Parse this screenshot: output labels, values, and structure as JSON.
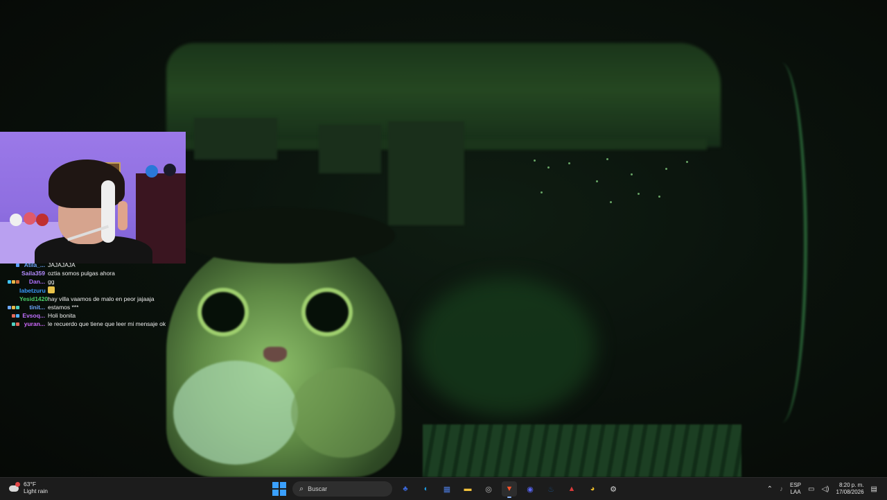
{
  "chat": [
    {
      "user": "Atila_...",
      "color": "#6ea8ff",
      "badges": [
        "#5aa0ff"
      ],
      "message": "JAJAJAJA",
      "emote": false
    },
    {
      "user": "Saila359",
      "color": "#b58cff",
      "badges": [],
      "message": "oztia somos pulgas ahora",
      "emote": false
    },
    {
      "user": "Dan...",
      "color": "#b070ff",
      "badges": [
        "#3fc6ff",
        "#e6b84a",
        "#d06a3a"
      ],
      "message": "gg",
      "emote": false
    },
    {
      "user": "labetzuru",
      "color": "#3a9cff",
      "badges": [],
      "message": "",
      "emote": true
    },
    {
      "user": "Yesid1420",
      "color": "#4cd06a",
      "badges": [],
      "message": "hay villa vaamos de malo en peor jajaaja",
      "emote": false
    },
    {
      "user": "tinit...",
      "color": "#6ea8ff",
      "badges": [
        "#6ea8ff",
        "#e6b84a",
        "#4cd0c0"
      ],
      "message": "estamos ***",
      "emote": false
    },
    {
      "user": "Evsoq...",
      "color": "#c070ff",
      "badges": [
        "#e06a5a",
        "#50b0ff"
      ],
      "message": "Holi bonita",
      "emote": false
    },
    {
      "user": "yuran...",
      "color": "#d06aff",
      "badges": [
        "#50d0c0",
        "#e06a5a"
      ],
      "message": "le recuerdo que tiene que leer mi mensaje ok",
      "emote": false
    }
  ],
  "taskbar": {
    "weather": {
      "temp": "63°F",
      "condition": "Light rain",
      "icon": "rain-cloud-icon"
    },
    "search_label": "Buscar",
    "apps": [
      {
        "name": "start-button",
        "icon": "windows-icon"
      },
      {
        "name": "zoom-it-app",
        "icon": "zoom-icon",
        "color": "#3a66d8",
        "glyph": "♣"
      },
      {
        "name": "edge-app",
        "icon": "edge-icon",
        "color": "#1f9be0",
        "glyph": "◐"
      },
      {
        "name": "store-app",
        "icon": "store-icon",
        "color": "#4a78d8",
        "glyph": "▦"
      },
      {
        "name": "file-explorer-app",
        "icon": "folder-icon",
        "color": "#f2c23c",
        "glyph": "▬"
      },
      {
        "name": "obs-app",
        "icon": "obs-icon",
        "color": "#bdbdbd",
        "glyph": "◎"
      },
      {
        "name": "brave-app",
        "icon": "brave-icon",
        "color": "#fb542b",
        "glyph": "▼"
      },
      {
        "name": "discord-app",
        "icon": "discord-icon",
        "color": "#5865f2",
        "glyph": "◉"
      },
      {
        "name": "steam-app",
        "icon": "steam-icon",
        "color": "#1b4a7a",
        "glyph": "♨"
      },
      {
        "name": "pdf-app",
        "icon": "pdf-icon",
        "color": "#d83a3a",
        "glyph": "▲"
      },
      {
        "name": "chrome-app",
        "icon": "chrome-icon",
        "color": "#e8b92a",
        "glyph": "◕"
      },
      {
        "name": "settings-app",
        "icon": "gear-icon",
        "color": "#d8d8d8",
        "glyph": "⚙"
      }
    ],
    "language": {
      "line1": "ESP",
      "line2": "LAA"
    },
    "time": "8:20 p. m.",
    "date": "17/08/2026"
  }
}
